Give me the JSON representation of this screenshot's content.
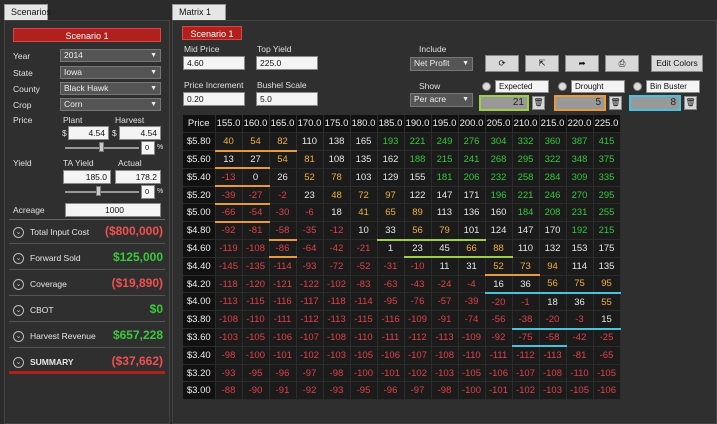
{
  "tabs": {
    "left": "Scenarios",
    "right": "Matrix 1",
    "right_close": "✕"
  },
  "scenario": {
    "title": "Scenario 1",
    "year_label": "Year",
    "year": "2014",
    "state_label": "State",
    "state": "Iowa",
    "county_label": "County",
    "county": "Black Hawk",
    "crop_label": "Crop",
    "crop": "Corn",
    "price_label": "Price",
    "plant_label": "Plant",
    "harvest_label": "Harvest",
    "plant_price": "4.54",
    "harvest_price": "4.54",
    "price_pct": "0",
    "yield_label": "Yield",
    "ta_yield_label": "TA Yield",
    "actual_label": "Actual",
    "ta_yield": "185.0",
    "actual_yield": "178.2",
    "yield_pct": "0",
    "acreage_label": "Acreage",
    "acreage": "1000",
    "dollar": "$",
    "percent": "%"
  },
  "summary": [
    {
      "label": "Total Input Cost",
      "value": "($800,000)",
      "color": "#f05050"
    },
    {
      "label": "Forward Sold",
      "value": "$125,000",
      "color": "#3cc83c"
    },
    {
      "label": "Coverage",
      "value": "($19,890)",
      "color": "#f05050"
    },
    {
      "label": "CBOT",
      "value": "$0",
      "color": "#3cc83c"
    },
    {
      "label": "Harvest Revenue",
      "value": "$657,228",
      "color": "#3cc83c"
    },
    {
      "label": "SUMMARY",
      "value": "($37,662)",
      "color": "#f05050"
    }
  ],
  "matrix_panel": {
    "scenario_button": "Scenario 1",
    "mid_price_label": "Mid Price",
    "mid_price": "4.60",
    "top_yield_label": "Top Yield",
    "top_yield": "225.0",
    "price_increment_label": "Price Increment",
    "price_increment": "0.20",
    "bushel_scale_label": "Bushel Scale",
    "bushel_scale": "5.0",
    "include_label": "Include",
    "include_value": "Net Profit",
    "show_label": "Show",
    "show_value": "Per acre",
    "edit_colors": "Edit Colors",
    "expected_label": "Expected",
    "expected_value": "21",
    "drought_label": "Drought",
    "drought_value": "5",
    "binbuster_label": "Bin Buster",
    "binbuster_value": "8",
    "colors": {
      "expected": "#9fce48",
      "drought": "#e69a3c",
      "binbuster": "#49c3dc"
    }
  },
  "matrix": {
    "header": [
      "Price",
      "155.0",
      "160.0",
      "165.0",
      "170.0",
      "175.0",
      "180.0",
      "185.0",
      "190.0",
      "195.0",
      "200.0",
      "205.0",
      "210.0",
      "215.0",
      "220.0",
      "225.0"
    ],
    "rows": [
      {
        "price": "$5.80",
        "values": [
          "40",
          "54",
          "82",
          "110",
          "138",
          "165",
          "193",
          "221",
          "249",
          "276",
          "304",
          "332",
          "360",
          "387",
          "415"
        ]
      },
      {
        "price": "$5.60",
        "values": [
          "13",
          "27",
          "54",
          "81",
          "108",
          "135",
          "162",
          "188",
          "215",
          "241",
          "268",
          "295",
          "322",
          "348",
          "375"
        ]
      },
      {
        "price": "$5.40",
        "values": [
          "-13",
          "0",
          "26",
          "52",
          "78",
          "103",
          "129",
          "155",
          "181",
          "206",
          "232",
          "258",
          "284",
          "309",
          "335"
        ]
      },
      {
        "price": "$5.20",
        "values": [
          "-39",
          "-27",
          "-2",
          "23",
          "48",
          "72",
          "97",
          "122",
          "147",
          "171",
          "196",
          "221",
          "246",
          "270",
          "295"
        ]
      },
      {
        "price": "$5.00",
        "values": [
          "-66",
          "-54",
          "-30",
          "-6",
          "18",
          "41",
          "65",
          "89",
          "113",
          "136",
          "160",
          "184",
          "208",
          "231",
          "255"
        ]
      },
      {
        "price": "$4.80",
        "values": [
          "-92",
          "-81",
          "-58",
          "-35",
          "-12",
          "10",
          "33",
          "56",
          "79",
          "101",
          "124",
          "147",
          "170",
          "192",
          "215"
        ]
      },
      {
        "price": "$4.60",
        "values": [
          "-119",
          "-108",
          "-86",
          "-64",
          "-42",
          "-21",
          "1",
          "23",
          "45",
          "66",
          "88",
          "110",
          "132",
          "153",
          "175"
        ]
      },
      {
        "price": "$4.40",
        "values": [
          "-145",
          "-135",
          "-114",
          "-93",
          "-72",
          "-52",
          "-31",
          "-10",
          "11",
          "31",
          "52",
          "73",
          "94",
          "114",
          "135"
        ]
      },
      {
        "price": "$4.20",
        "values": [
          "-118",
          "-120",
          "-121",
          "-122",
          "-102",
          "-83",
          "-63",
          "-43",
          "-24",
          "-4",
          "16",
          "36",
          "56",
          "75",
          "95"
        ]
      },
      {
        "price": "$4.00",
        "values": [
          "-113",
          "-115",
          "-116",
          "-117",
          "-118",
          "-114",
          "-95",
          "-76",
          "-57",
          "-39",
          "-20",
          "-1",
          "18",
          "36",
          "55"
        ]
      },
      {
        "price": "$3.80",
        "values": [
          "-108",
          "-110",
          "-111",
          "-112",
          "-113",
          "-115",
          "-116",
          "-109",
          "-91",
          "-74",
          "-56",
          "-38",
          "-20",
          "-3",
          "15"
        ]
      },
      {
        "price": "$3.60",
        "values": [
          "-103",
          "-105",
          "-106",
          "-107",
          "-108",
          "-110",
          "-111",
          "-112",
          "-113",
          "-109",
          "-92",
          "-75",
          "-58",
          "-42",
          "-25"
        ]
      },
      {
        "price": "$3.40",
        "values": [
          "-98",
          "-100",
          "-101",
          "-102",
          "-103",
          "-105",
          "-106",
          "-107",
          "-108",
          "-110",
          "-111",
          "-112",
          "-113",
          "-81",
          "-65"
        ]
      },
      {
        "price": "$3.20",
        "values": [
          "-93",
          "-95",
          "-96",
          "-97",
          "-98",
          "-100",
          "-101",
          "-102",
          "-103",
          "-105",
          "-106",
          "-107",
          "-108",
          "-110",
          "-105"
        ]
      },
      {
        "price": "$3.00",
        "values": [
          "-88",
          "-90",
          "-91",
          "-92",
          "-93",
          "-95",
          "-96",
          "-97",
          "-98",
          "-100",
          "-101",
          "-102",
          "-103",
          "-105",
          "-106"
        ]
      }
    ]
  }
}
